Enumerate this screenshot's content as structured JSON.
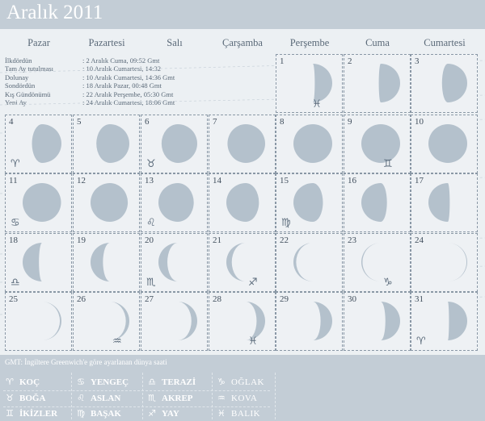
{
  "title": "Aralık 2011",
  "day_names": [
    "Pazar",
    "Pazartesi",
    "Salı",
    "Çarşamba",
    "Perşembe",
    "Cuma",
    "Cumartesi"
  ],
  "info": [
    {
      "label": "İlkdördün",
      "value": ": 2 Aralık Cuma, 09:52 Gmt"
    },
    {
      "label": "Tam Ay tutulması",
      "value": ": 10 Aralık Cumartesi, 14:32"
    },
    {
      "label": "Dolunay",
      "value": ": 10 Aralık Cumartesi, 14:36 Gmt"
    },
    {
      "label": "Sondördün",
      "value": ": 18 Aralık Pazar, 00:48 Gmt"
    },
    {
      "label": "Kış Gündönümü",
      "value": ": 22 Aralık Perşembe,  05:30 Gmt"
    },
    {
      "label": "Yeni Ay",
      "value": ": 24 Aralık Cumartesi, 18:06  Gmt"
    }
  ],
  "days": [
    {
      "n": "1",
      "ill": 0.45,
      "wax": true,
      "sign": "♓"
    },
    {
      "n": "2",
      "ill": 0.55,
      "wax": true,
      "sign": ""
    },
    {
      "n": "3",
      "ill": 0.65,
      "wax": true,
      "sign": ""
    },
    {
      "n": "4",
      "ill": 0.76,
      "wax": true,
      "sign": "♈"
    },
    {
      "n": "5",
      "ill": 0.85,
      "wax": true,
      "sign": ""
    },
    {
      "n": "6",
      "ill": 0.92,
      "wax": true,
      "sign": "♉"
    },
    {
      "n": "7",
      "ill": 0.97,
      "wax": true,
      "sign": ""
    },
    {
      "n": "8",
      "ill": 1.0,
      "wax": true,
      "sign": ""
    },
    {
      "n": "9",
      "ill": 1.0,
      "wax": true,
      "sign": "♊"
    },
    {
      "n": "10",
      "ill": 1.0,
      "wax": true,
      "sign": ""
    },
    {
      "n": "11",
      "ill": 0.99,
      "wax": false,
      "sign": "♋"
    },
    {
      "n": "12",
      "ill": 0.96,
      "wax": false,
      "sign": ""
    },
    {
      "n": "13",
      "ill": 0.91,
      "wax": false,
      "sign": "♌"
    },
    {
      "n": "14",
      "ill": 0.84,
      "wax": false,
      "sign": ""
    },
    {
      "n": "15",
      "ill": 0.76,
      "wax": false,
      "sign": "♍"
    },
    {
      "n": "16",
      "ill": 0.66,
      "wax": false,
      "sign": ""
    },
    {
      "n": "17",
      "ill": 0.55,
      "wax": false,
      "sign": ""
    },
    {
      "n": "18",
      "ill": 0.42,
      "wax": false,
      "sign": "♎"
    },
    {
      "n": "19",
      "ill": 0.32,
      "wax": false,
      "sign": ""
    },
    {
      "n": "20",
      "ill": 0.23,
      "wax": false,
      "sign": "♏"
    },
    {
      "n": "21",
      "ill": 0.14,
      "wax": false,
      "sign": "♐"
    },
    {
      "n": "22",
      "ill": 0.07,
      "wax": false,
      "sign": ""
    },
    {
      "n": "23",
      "ill": 0.03,
      "wax": false,
      "sign": "♑"
    },
    {
      "n": "24",
      "ill": 0.02,
      "wax": true,
      "sign": ""
    },
    {
      "n": "25",
      "ill": 0.04,
      "wax": true,
      "sign": ""
    },
    {
      "n": "26",
      "ill": 0.09,
      "wax": true,
      "sign": "♒"
    },
    {
      "n": "27",
      "ill": 0.15,
      "wax": true,
      "sign": ""
    },
    {
      "n": "28",
      "ill": 0.22,
      "wax": true,
      "sign": "♓"
    },
    {
      "n": "29",
      "ill": 0.3,
      "wax": true,
      "sign": ""
    },
    {
      "n": "30",
      "ill": 0.38,
      "wax": true,
      "sign": ""
    },
    {
      "n": "31",
      "ill": 0.47,
      "wax": true,
      "sign": "♈"
    }
  ],
  "gmt_note": "GMT: İngiltere Greenwich'e göre ayarlanan dünya saati",
  "legend": [
    {
      "sym": "♈",
      "label": "KOÇ",
      "style": "bold"
    },
    {
      "sym": "♉",
      "label": "BOĞA",
      "style": "bold"
    },
    {
      "sym": "♊",
      "label": "İKİZLER",
      "style": "bold"
    },
    {
      "sym": "♋",
      "label": "YENGEÇ",
      "style": "bold"
    },
    {
      "sym": "♌",
      "label": "ASLAN",
      "style": "bold"
    },
    {
      "sym": "♍",
      "label": "BAŞAK",
      "style": "bold"
    },
    {
      "sym": "♎",
      "label": "TERAZİ",
      "style": "bold"
    },
    {
      "sym": "♏",
      "label": "AKREP",
      "style": "bold"
    },
    {
      "sym": "♐",
      "label": "YAY",
      "style": "bold"
    },
    {
      "sym": "♑",
      "label": "OĞLAK",
      "style": "light"
    },
    {
      "sym": "♒",
      "label": "KOVA",
      "style": "light"
    },
    {
      "sym": "♓",
      "label": "BALIK",
      "style": "light"
    }
  ],
  "colors": {
    "header": "#c3cdd6",
    "moon": "#b4c1cc",
    "cell_border": "#8a98a6",
    "text": "#5a6978"
  }
}
